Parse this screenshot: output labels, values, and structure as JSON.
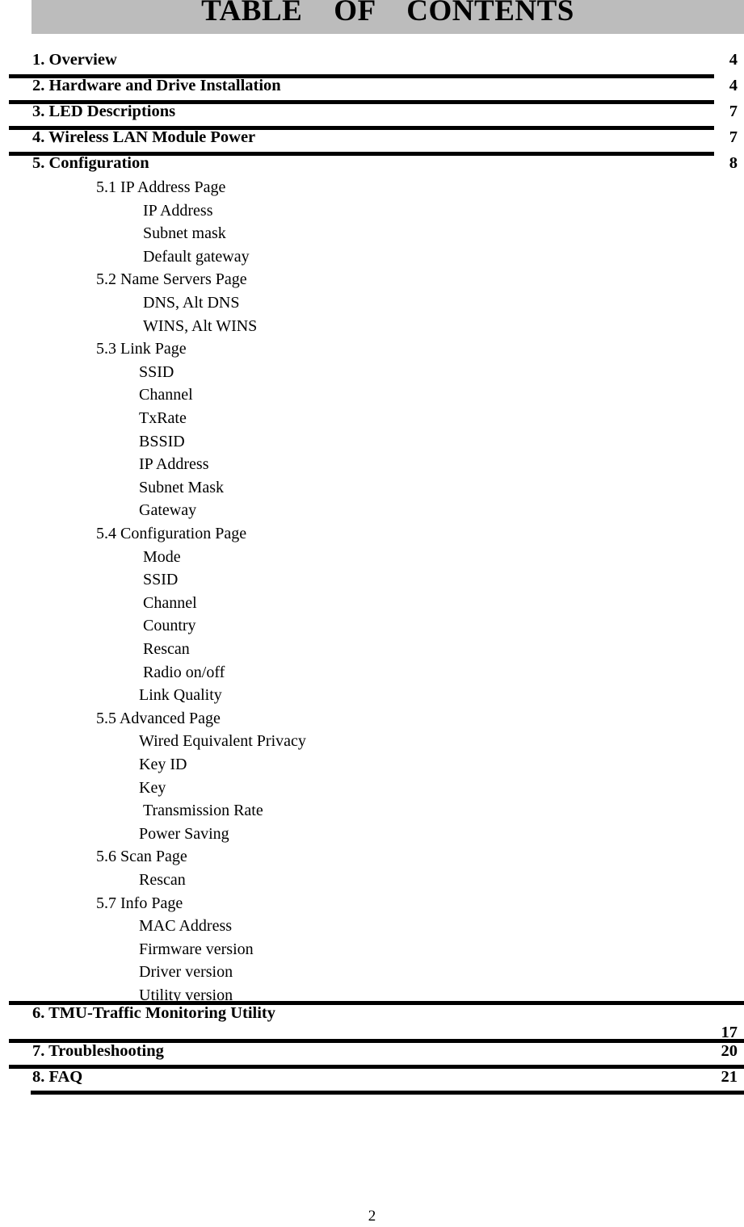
{
  "header": {
    "title": "TABLE    OF    CONTENTS"
  },
  "toc": {
    "entries": [
      {
        "label": "1. Overview",
        "page": "4"
      },
      {
        "label": "2. Hardware and Drive Installation",
        "page": "4"
      },
      {
        "label": "3. LED Descriptions",
        "page": "7"
      },
      {
        "label": "4. Wireless LAN Module Power",
        "page": "7"
      },
      {
        "label": "5. Configuration",
        "page": "8"
      },
      {
        "label": "6. TMU-Traffic Monitoring Utility",
        "page": "17"
      },
      {
        "label": "7. Troubleshooting",
        "page": "20"
      },
      {
        "label": "8. FAQ",
        "page": "21"
      }
    ],
    "subsections": [
      {
        "label": "5.1 IP Address Page"
      },
      {
        "label": "IP Address"
      },
      {
        "label": "Subnet mask"
      },
      {
        "label": "Default gateway"
      },
      {
        "label": "5.2 Name Servers Page"
      },
      {
        "label": "DNS, Alt DNS"
      },
      {
        "label": "WINS, Alt WINS"
      },
      {
        "label": "5.3 Link Page"
      },
      {
        "label": "SSID"
      },
      {
        "label": "Channel"
      },
      {
        "label": "TxRate"
      },
      {
        "label": "BSSID"
      },
      {
        "label": "IP Address"
      },
      {
        "label": "Subnet Mask"
      },
      {
        "label": "Gateway"
      },
      {
        "label": "5.4 Configuration Page"
      },
      {
        "label": "Mode"
      },
      {
        "label": "SSID"
      },
      {
        "label": "Channel"
      },
      {
        "label": "Country"
      },
      {
        "label": "Rescan"
      },
      {
        "label": "Radio on/off"
      },
      {
        "label": "Link Quality"
      },
      {
        "label": "5.5 Advanced Page"
      },
      {
        "label": "Wired Equivalent Privacy"
      },
      {
        "label": "Key ID"
      },
      {
        "label": "Key"
      },
      {
        "label": "Transmission Rate"
      },
      {
        "label": "Power Saving"
      },
      {
        "label": "5.6 Scan Page"
      },
      {
        "label": "Rescan"
      },
      {
        "label": "5.7 Info Page"
      },
      {
        "label": "MAC Address"
      },
      {
        "label": "Firmware version"
      },
      {
        "label": "Driver version"
      },
      {
        "label": "Utility version"
      }
    ]
  },
  "footer": {
    "page_number": "2"
  }
}
